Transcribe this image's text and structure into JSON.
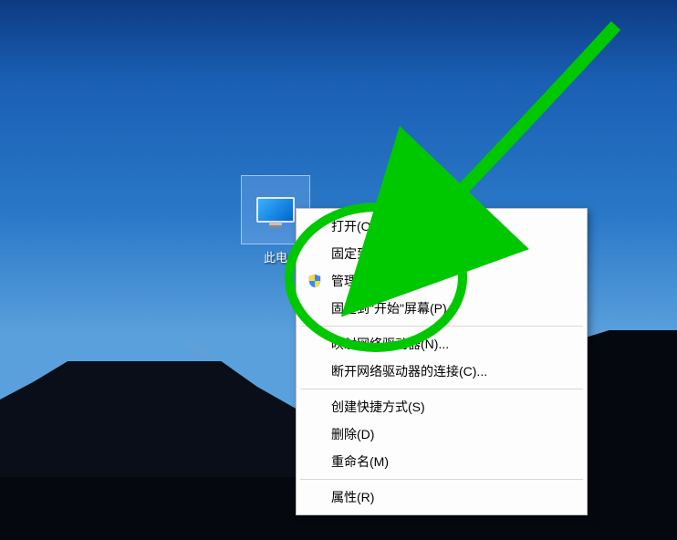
{
  "desktop": {
    "icon_label": "此电"
  },
  "menu": {
    "open": "打开(O)",
    "pin_quick": "固定到\"快速访问\"",
    "manage": "管理(G)",
    "pin_start": "固定到\"开始\"屏幕(P)",
    "map_drive": "映射网络驱动器(N)...",
    "disconnect_drive": "断开网络驱动器的连接(C)...",
    "create_shortcut": "创建快捷方式(S)",
    "delete": "删除(D)",
    "rename": "重命名(M)",
    "properties": "属性(R)"
  },
  "annotation": {
    "highlight_target": "manage",
    "color": "#00c800"
  }
}
